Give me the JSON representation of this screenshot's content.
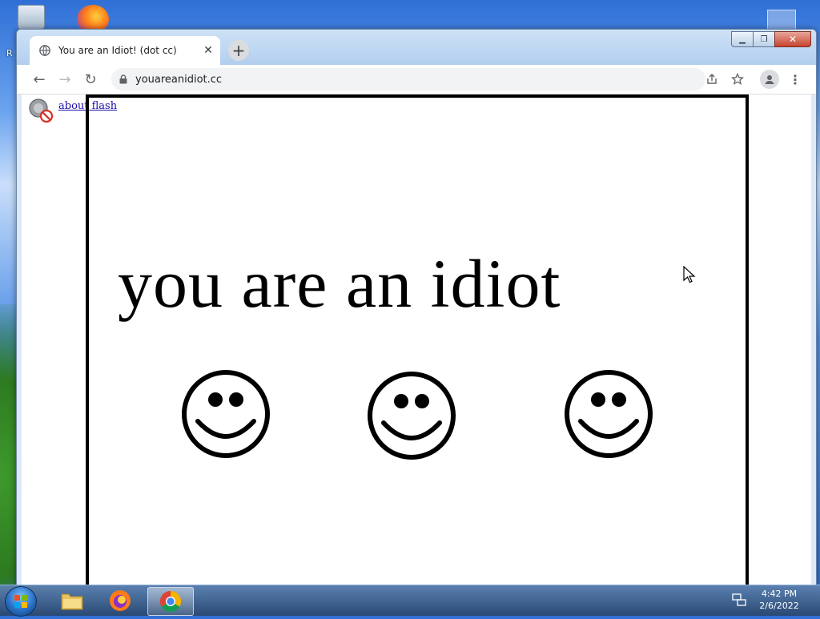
{
  "desktop": {
    "left_label": "R"
  },
  "browser": {
    "tab": {
      "title": "You are an Idiot! (dot cc)",
      "close_glyph": "✕"
    },
    "new_tab_glyph": "+",
    "nav": {
      "back": "←",
      "forward": "→",
      "reload": "↻"
    },
    "omnibox": {
      "url": "youareanidiot.cc"
    },
    "menu_glyph": "⋮",
    "window_controls": {
      "minimize": "▁",
      "maximize": "❐",
      "close": "✕"
    }
  },
  "page": {
    "flash_link": "about flash",
    "headline": "you are an idiot",
    "smiley_count": 3
  },
  "taskbar": {
    "apps": [
      {
        "name": "Windows Explorer",
        "icon": "folder-icon"
      },
      {
        "name": "Firefox",
        "icon": "firefox-icon"
      },
      {
        "name": "Google Chrome",
        "icon": "chrome-icon"
      }
    ],
    "clock": {
      "time": "4:42 PM",
      "date": "2/6/2022"
    }
  },
  "colors": {
    "link": "#1a0dab",
    "headline": "#000000",
    "close_button": "#c7422e"
  }
}
